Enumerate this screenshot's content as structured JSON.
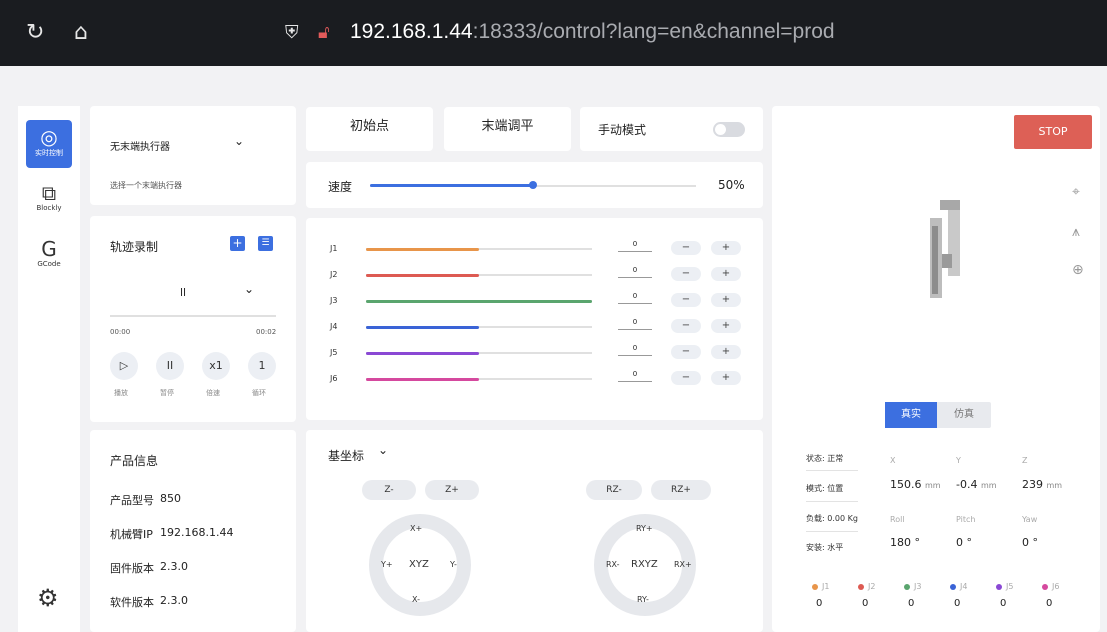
{
  "browser": {
    "url_host": "192.168.1.44",
    "url_rest": ":18333/control?lang=en&channel=prod"
  },
  "nav": {
    "items": [
      {
        "label": "实时控制",
        "icon": "target-icon"
      },
      {
        "label": "Blockly",
        "icon": "puzzle-icon"
      },
      {
        "label": "GCode",
        "icon": "g-icon"
      }
    ]
  },
  "effector": {
    "selected": "无末端执行器",
    "hint": "选择一个末端执行器"
  },
  "traj": {
    "title": "轨迹录制",
    "selected": "ll",
    "time_start": "00:00",
    "time_end": "00:02",
    "controls": [
      {
        "glyph": "▷",
        "label": "播放"
      },
      {
        "glyph": "II",
        "label": "暂停"
      },
      {
        "glyph": "x1",
        "label": "倍速"
      },
      {
        "glyph": "1",
        "label": "循环"
      }
    ]
  },
  "product": {
    "title": "产品信息",
    "rows": [
      {
        "k": "产品型号",
        "v": "850"
      },
      {
        "k": "机械臂IP",
        "v": "192.168.1.44"
      },
      {
        "k": "固件版本",
        "v": "2.3.0"
      },
      {
        "k": "软件版本",
        "v": "2.3.0"
      }
    ]
  },
  "top": {
    "home": "初始点",
    "level": "末端调平",
    "manual": "手动模式"
  },
  "speed": {
    "label": "速度",
    "value_text": "50%",
    "fraction": 0.5
  },
  "joints": [
    {
      "name": "J1",
      "value": "0",
      "fraction": 0.5,
      "color": "#e8954a"
    },
    {
      "name": "J2",
      "value": "0",
      "fraction": 0.5,
      "color": "#dd5a52"
    },
    {
      "name": "J3",
      "value": "0",
      "fraction": 1.0,
      "color": "#5aa56e"
    },
    {
      "name": "J4",
      "value": "0",
      "fraction": 0.5,
      "color": "#3a63d6"
    },
    {
      "name": "J5",
      "value": "0",
      "fraction": 0.5,
      "color": "#8a48d4"
    },
    {
      "name": "J6",
      "value": "0",
      "fraction": 0.5,
      "color": "#d5499e"
    }
  ],
  "pm": {
    "minus": "−",
    "plus": "+"
  },
  "coord": {
    "title": "基坐标",
    "z_minus": "Z-",
    "z_plus": "Z+",
    "rz_minus": "RZ-",
    "rz_plus": "RZ+",
    "xyz": {
      "center": "XYZ",
      "top": "X+",
      "bottom": "X-",
      "left": "Y+",
      "right": "Y-"
    },
    "rxyz": {
      "center": "RXYZ",
      "top": "RY+",
      "bottom": "RY-",
      "left": "RX-",
      "right": "RX+"
    }
  },
  "view": {
    "stop": "STOP",
    "real": "真实",
    "sim": "仿真"
  },
  "status": {
    "state": "状态: 正常",
    "mode": "模式: 位置",
    "load": "负载: 0.00 Kg",
    "mount": "安装: 水平",
    "pos": [
      {
        "h": "X",
        "v": "150.6",
        "u": "mm"
      },
      {
        "h": "Y",
        "v": "-0.4",
        "u": "mm"
      },
      {
        "h": "Z",
        "v": "239",
        "u": "mm"
      }
    ],
    "rot": [
      {
        "h": "Roll",
        "v": "180 °"
      },
      {
        "h": "Pitch",
        "v": "0 °"
      },
      {
        "h": "Yaw",
        "v": "0 °"
      }
    ],
    "joints": [
      {
        "n": "J1",
        "v": "0",
        "c": "#e8954a"
      },
      {
        "n": "J2",
        "v": "0",
        "c": "#dd5a52"
      },
      {
        "n": "J3",
        "v": "0",
        "c": "#5aa56e"
      },
      {
        "n": "J4",
        "v": "0",
        "c": "#3a63d6"
      },
      {
        "n": "J5",
        "v": "0",
        "c": "#8a48d4"
      },
      {
        "n": "J6",
        "v": "0",
        "c": "#d5499e"
      }
    ]
  }
}
